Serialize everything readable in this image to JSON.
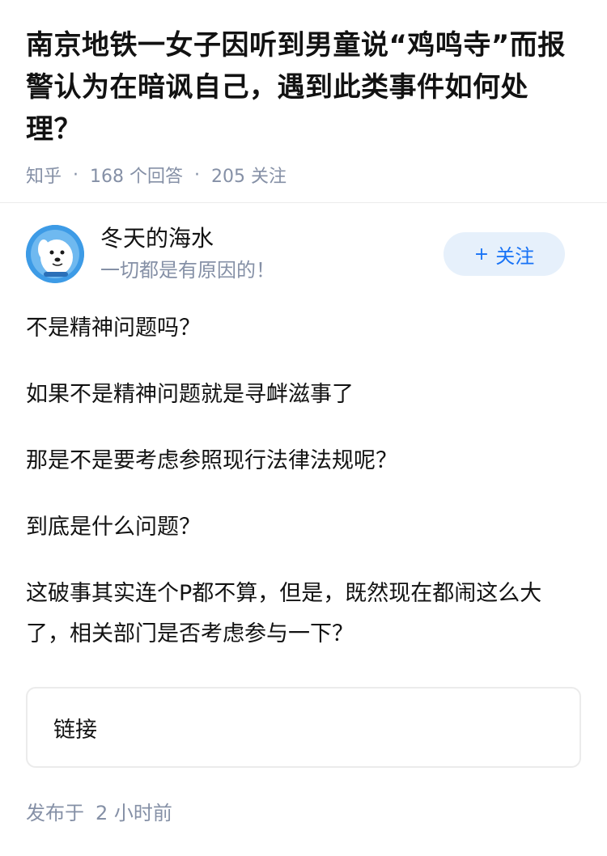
{
  "question": {
    "title": "南京地铁一女子因听到男童说“鸡鸣寺”而报警认为在暗讽自己，遇到此类事件如何处理？",
    "meta": {
      "source": "知乎",
      "answers": "168 个回答",
      "follows": "205 关注"
    }
  },
  "answer": {
    "author": {
      "name": "冬天的海水",
      "bio": "一切都是有原因的！",
      "avatar_icon": "cartoon-dog-avatar"
    },
    "follow_button": {
      "plus": "+",
      "label": "关注"
    },
    "paragraphs": [
      "不是精神问题吗？",
      "如果不是精神问题就是寻衅滋事了",
      "那是不是要考虑参照现行法律法规呢？",
      "到底是什么问题？",
      "这破事其实连个P都不算，但是，既然现在都闹这么大了，相关部门是否考虑参与一下？"
    ],
    "link_card": {
      "label": "链接"
    },
    "published": {
      "prefix": "发布于",
      "time": "2 小时前"
    }
  },
  "colors": {
    "text": "#121212",
    "muted": "#8590a6",
    "accent": "#1772f6",
    "follow_bg": "#e6f0fb",
    "avatar_bg": "#3d9be6"
  }
}
